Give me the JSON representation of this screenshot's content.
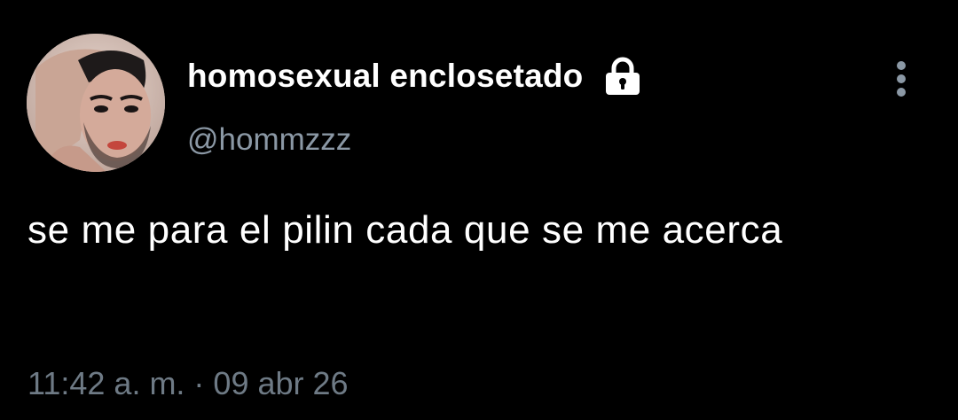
{
  "tweet": {
    "author": {
      "display_name": "homosexual enclosetado",
      "handle": "@hommzzz",
      "avatar_icon": "user-avatar-photo",
      "protected_icon": "lock-icon"
    },
    "text": "se me para el pilin cada que se me acerca",
    "timestamp": "11:42 a. m. · 09 abr 26",
    "more_icon": "more-vertical-icon"
  },
  "colors": {
    "background": "#000000",
    "primary_text": "#ffffff",
    "secondary_text": "#8b98a5",
    "timestamp_text": "#6e7a85"
  }
}
